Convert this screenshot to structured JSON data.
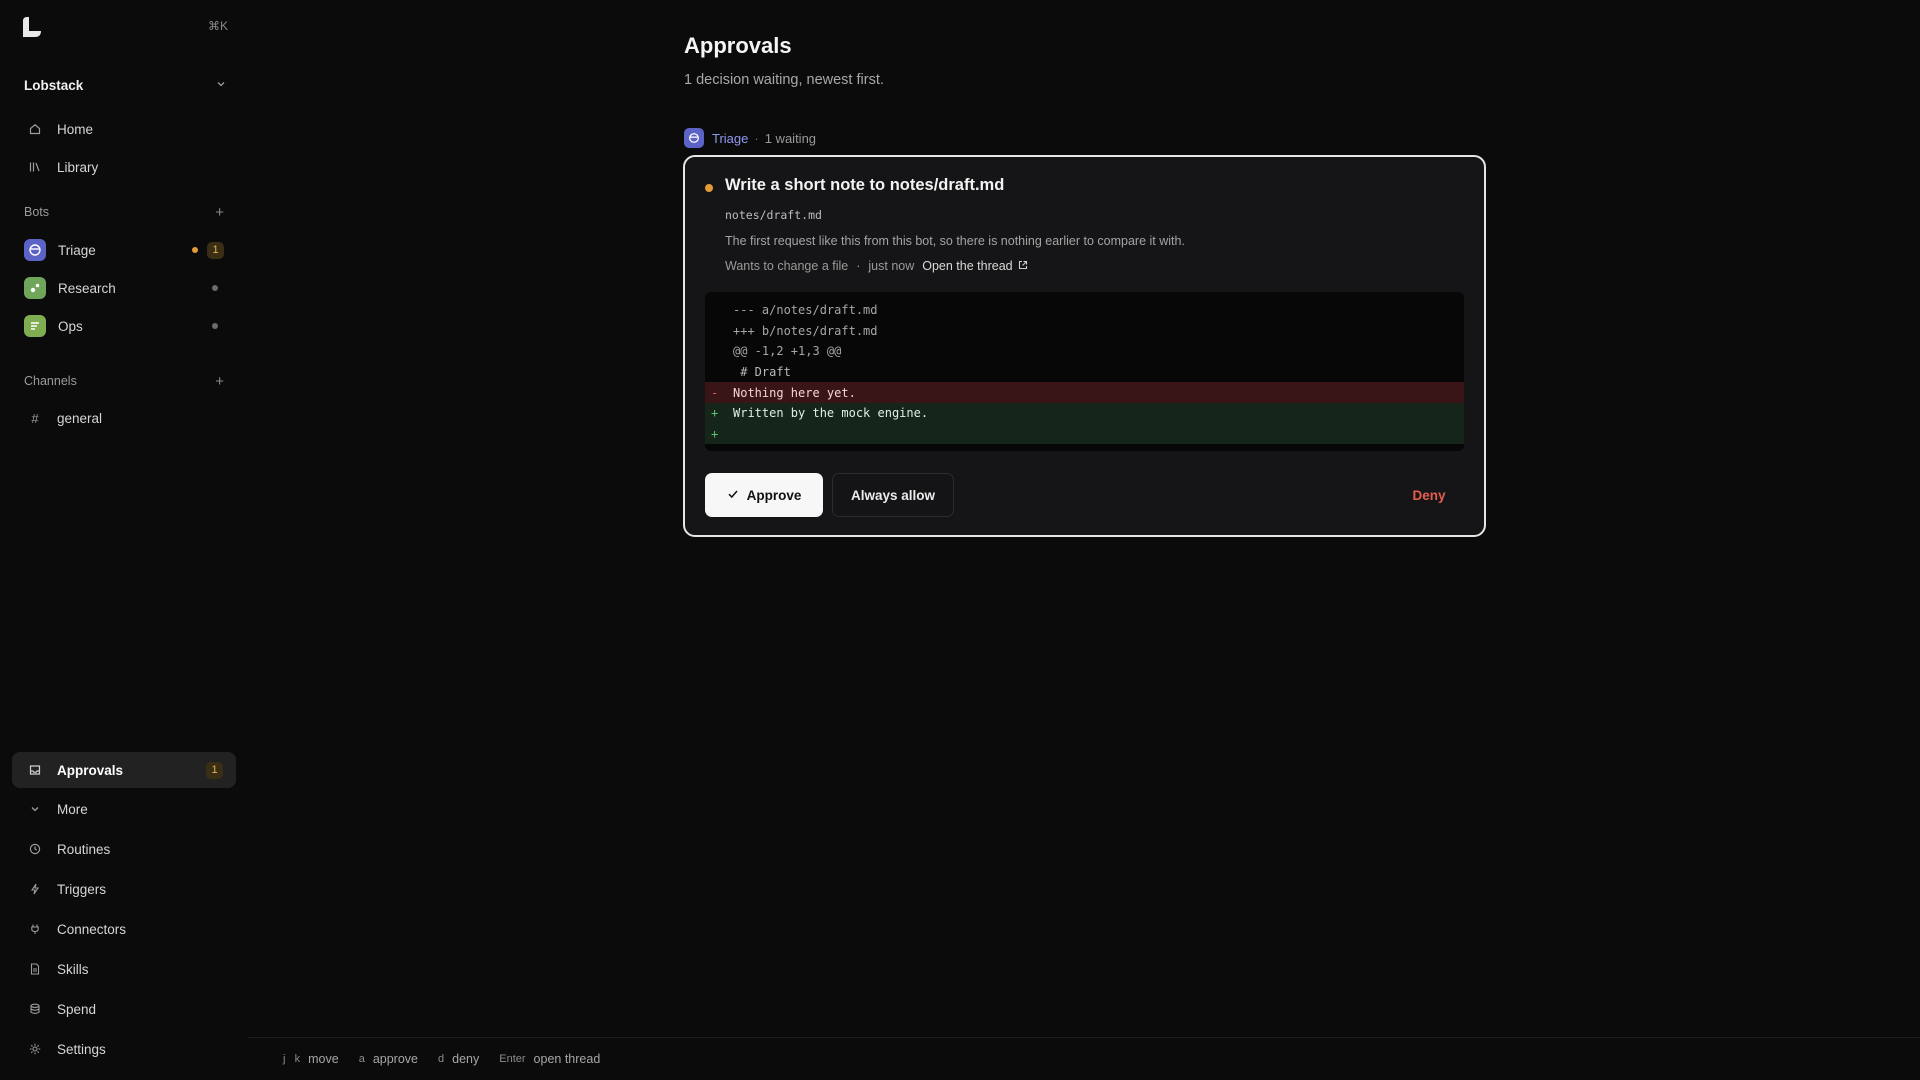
{
  "app": {
    "shortcut_hint": "⌘K",
    "workspace_name": "Lobstack"
  },
  "sidebar": {
    "primary": [
      {
        "label": "Home",
        "icon": "home-icon"
      },
      {
        "label": "Library",
        "icon": "library-icon"
      }
    ],
    "bots_header": "Bots",
    "bots": [
      {
        "label": "Triage",
        "status": "active",
        "count": "1",
        "color": "#5b63c6"
      },
      {
        "label": "Research",
        "status": "idle",
        "color": "#6fa65a"
      },
      {
        "label": "Ops",
        "status": "idle",
        "color": "#7fae52"
      }
    ],
    "channels_header": "Channels",
    "channels": [
      {
        "label": "general"
      }
    ],
    "approvals": {
      "label": "Approvals",
      "count": "1"
    },
    "more_label": "More",
    "secondary": [
      {
        "label": "Routines",
        "icon": "clock-icon"
      },
      {
        "label": "Triggers",
        "icon": "bolt-icon"
      },
      {
        "label": "Connectors",
        "icon": "plug-icon"
      },
      {
        "label": "Skills",
        "icon": "document-icon"
      },
      {
        "label": "Spend",
        "icon": "database-icon"
      },
      {
        "label": "Settings",
        "icon": "gear-icon"
      }
    ]
  },
  "main": {
    "title": "Approvals",
    "subtitle": "1 decision waiting, newest first.",
    "group": {
      "bot": "Triage",
      "separator": "·",
      "count_text": "1 waiting"
    },
    "card": {
      "title": "Write a short note to notes/draft.md",
      "path": "notes/draft.md",
      "description": "The first request like this from this bot, so there is nothing earlier to compare it with.",
      "action": "Wants to change a file",
      "separator": "·",
      "time": "just now",
      "open_link": "Open the thread",
      "diff": [
        {
          "type": "meta",
          "gutter": "",
          "text": "--- a/notes/draft.md"
        },
        {
          "type": "meta",
          "gutter": "",
          "text": "+++ b/notes/draft.md"
        },
        {
          "type": "meta",
          "gutter": "",
          "text": "@@ -1,2 +1,3 @@"
        },
        {
          "type": "context",
          "gutter": "",
          "text": " # Draft"
        },
        {
          "type": "del",
          "gutter": "-",
          "text": "Nothing here yet."
        },
        {
          "type": "add",
          "gutter": "+",
          "text": "Written by the mock engine."
        },
        {
          "type": "add",
          "gutter": "+",
          "text": ""
        }
      ],
      "approve_label": "Approve",
      "always_allow_label": "Always allow",
      "deny_label": "Deny"
    }
  },
  "footer": {
    "hints": [
      {
        "keys": "j   k",
        "desc": "move"
      },
      {
        "keys": "a",
        "desc": "approve"
      },
      {
        "keys": "d",
        "desc": "deny"
      },
      {
        "keys": "Enter",
        "desc": "open thread"
      }
    ]
  },
  "colors": {
    "accent_orange": "#e39b3a",
    "deny_red": "#e55d4f",
    "triage_blue": "#8f98f2"
  }
}
